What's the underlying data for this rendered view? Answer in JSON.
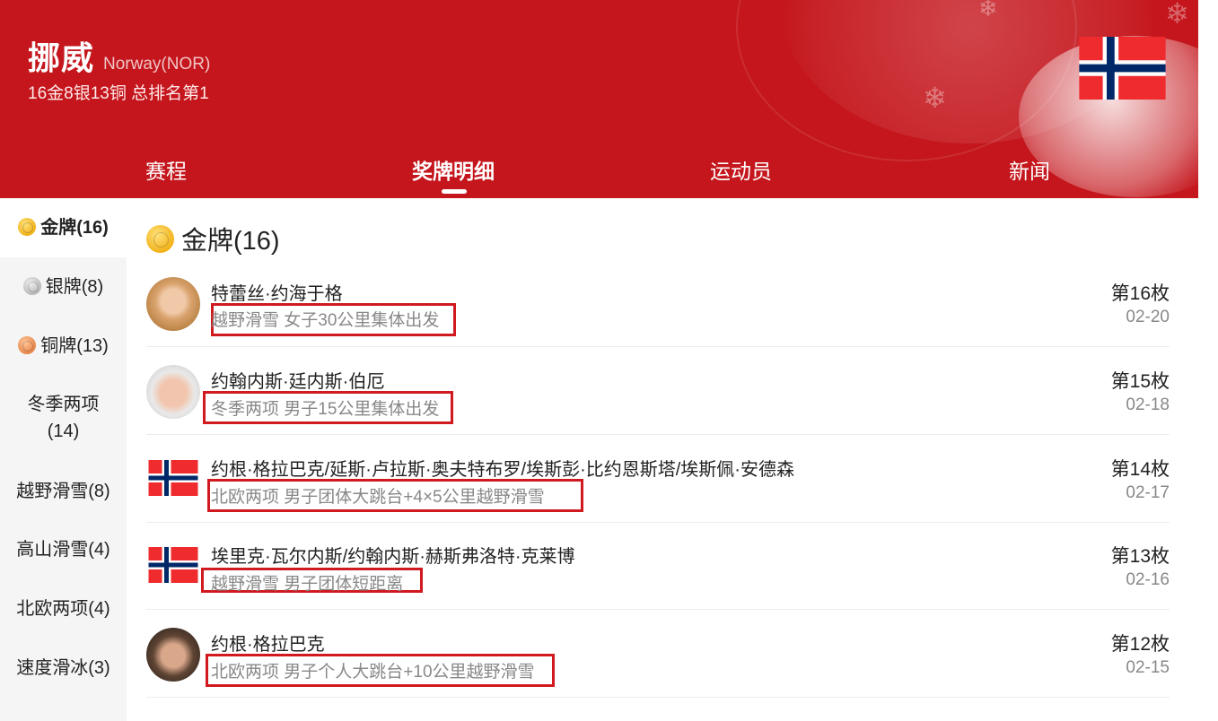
{
  "header": {
    "country_name": "挪威",
    "country_en": "Norway(NOR)",
    "summary": "16金8银13铜 总排名第1",
    "flag_icon": "norway-flag-icon",
    "background_color": "#c4161c"
  },
  "tabs": [
    {
      "label": "赛程",
      "active": false
    },
    {
      "label": "奖牌明细",
      "active": true
    },
    {
      "label": "运动员",
      "active": false
    },
    {
      "label": "新闻",
      "active": false
    }
  ],
  "sidebar": {
    "items": [
      {
        "label": "金牌(16)",
        "icon": "gold-medal-icon",
        "active": true
      },
      {
        "label": "银牌(8)",
        "icon": "silver-medal-icon",
        "active": false
      },
      {
        "label": "铜牌(13)",
        "icon": "bronze-medal-icon",
        "active": false
      },
      {
        "label": "冬季两项(14)",
        "icon": "",
        "active": false
      },
      {
        "label": "越野滑雪(8)",
        "icon": "",
        "active": false
      },
      {
        "label": "高山滑雪(4)",
        "icon": "",
        "active": false
      },
      {
        "label": "北欧两项(4)",
        "icon": "",
        "active": false
      },
      {
        "label": "速度滑冰(3)",
        "icon": "",
        "active": false
      }
    ]
  },
  "section": {
    "title": "金牌(16)",
    "icon": "gold-medal-icon"
  },
  "medals": [
    {
      "athlete": "特蕾丝·约海于格",
      "event": "越野滑雪 女子30公里集体出发",
      "rank": "第16枚",
      "date": "02-20",
      "image": "athlete-photo"
    },
    {
      "athlete": "约翰内斯·廷内斯·伯厄",
      "event": "冬季两项 男子15公里集体出发",
      "rank": "第15枚",
      "date": "02-18",
      "image": "athlete-photo"
    },
    {
      "athlete": "约根·格拉巴克/延斯·卢拉斯·奥夫特布罗/埃斯彭·比约恩斯塔/埃斯佩·安德森",
      "event": "北欧两项 男子团体大跳台+4×5公里越野滑雪",
      "rank": "第14枚",
      "date": "02-17",
      "image": "norway-flag"
    },
    {
      "athlete": "埃里克·瓦尔内斯/约翰内斯·赫斯弗洛特·克莱博",
      "event": "越野滑雪 男子团体短距离",
      "rank": "第13枚",
      "date": "02-16",
      "image": "norway-flag"
    },
    {
      "athlete": "约根·格拉巴克",
      "event": "北欧两项 男子个人大跳台+10公里越野滑雪",
      "rank": "第12枚",
      "date": "02-15",
      "image": "athlete-photo"
    }
  ],
  "colors": {
    "accent_red": "#c4161c",
    "highlight_box": "#d01a1f",
    "gold": "#f2b21b",
    "silver": "#b8b8b8",
    "bronze": "#e8864a"
  }
}
